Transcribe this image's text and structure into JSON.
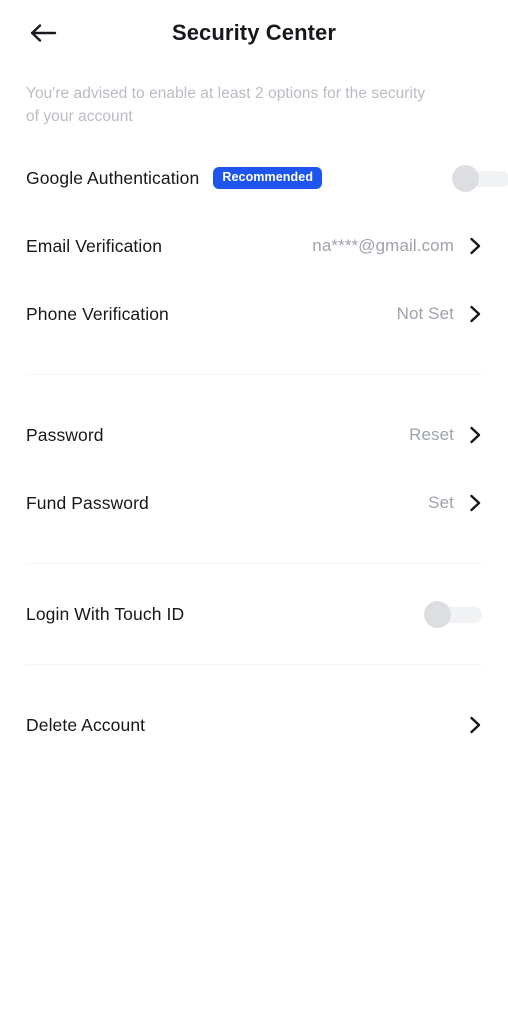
{
  "header": {
    "back_icon": "arrow-left-icon",
    "title": "Security Center"
  },
  "advisory": {
    "text": "You're advised to enable at least 2 options for the security of your account"
  },
  "colors": {
    "badge_background": "#1f55ef",
    "badge_text": "#ffffff",
    "label_text": "#16181c",
    "value_text": "#9fa3aa",
    "advisory_text": "#b9bcc2",
    "divider": "#f4f5f6",
    "toggle_knob_off": "#dcdee1",
    "toggle_track_off": "#f1f2f4",
    "background": "#ffffff"
  },
  "groups": [
    {
      "name": "verification-group",
      "rows": [
        {
          "name": "google-authentication",
          "label": "Google Authentication",
          "badge": "Recommended",
          "control": "toggle",
          "toggle_state": "off",
          "value": "",
          "chevron": false
        },
        {
          "name": "email-verification",
          "label": "Email Verification",
          "badge": "",
          "control": "chevron",
          "value": "na****@gmail.com",
          "chevron": true
        },
        {
          "name": "phone-verification",
          "label": "Phone Verification",
          "badge": "",
          "control": "chevron",
          "value": "Not Set",
          "chevron": true
        }
      ]
    },
    {
      "name": "password-group",
      "rows": [
        {
          "name": "password",
          "label": "Password",
          "badge": "",
          "control": "chevron",
          "value": "Reset",
          "chevron": true
        },
        {
          "name": "fund-password",
          "label": "Fund Password",
          "badge": "",
          "control": "chevron",
          "value": "Set",
          "chevron": true
        }
      ]
    },
    {
      "name": "biometrics-group",
      "rows": [
        {
          "name": "login-with-touch-id",
          "label": "Login With Touch ID",
          "badge": "",
          "control": "toggle",
          "toggle_state": "off",
          "value": "",
          "chevron": false
        }
      ]
    },
    {
      "name": "account-group",
      "rows": [
        {
          "name": "delete-account",
          "label": "Delete Account",
          "badge": "",
          "control": "chevron",
          "value": "",
          "chevron": true
        }
      ]
    }
  ]
}
